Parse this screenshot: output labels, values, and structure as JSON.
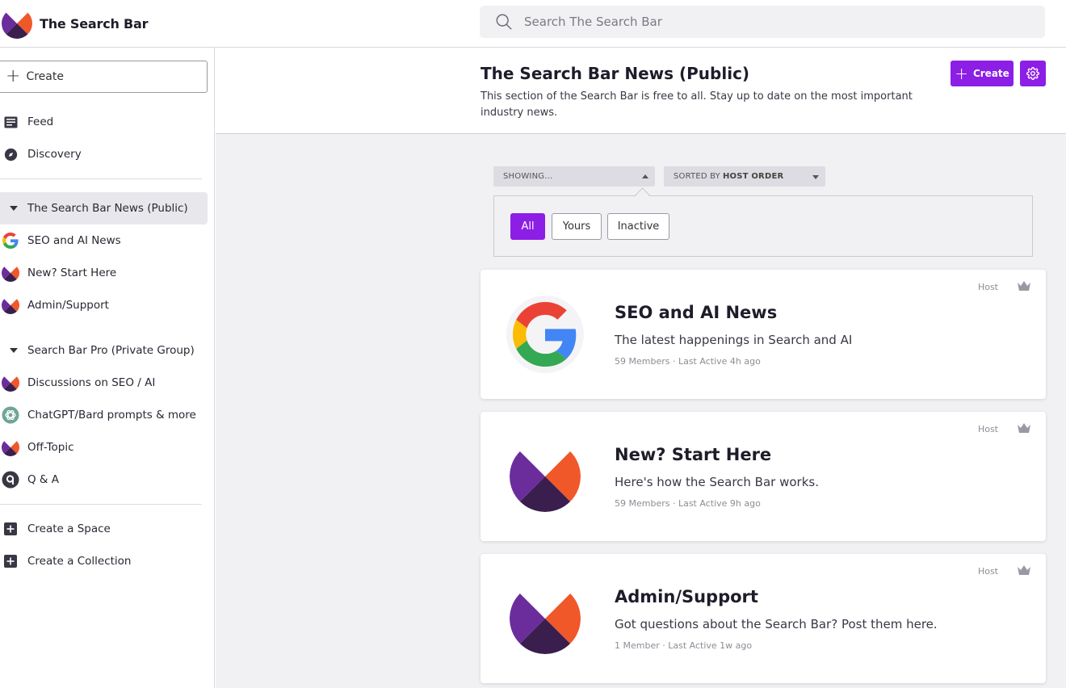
{
  "app": {
    "name": "The Search Bar"
  },
  "search": {
    "placeholder": "Search The Search Bar"
  },
  "sidebar": {
    "create_label": "Create",
    "top_items": [
      {
        "label": "Feed",
        "icon": "feed-icon"
      },
      {
        "label": "Discovery",
        "icon": "compass-icon"
      }
    ],
    "groups": [
      {
        "label": "The Search Bar News (Public)",
        "expanded": true,
        "items": [
          {
            "label": "SEO and AI News",
            "icon": "google-icon"
          },
          {
            "label": "New? Start Here",
            "icon": "search-bar-logo-icon"
          },
          {
            "label": "Admin/Support",
            "icon": "search-bar-logo-icon"
          }
        ]
      },
      {
        "label": "Search Bar Pro (Private Group)",
        "expanded": true,
        "items": [
          {
            "label": "Discussions on SEO / AI",
            "icon": "search-bar-logo-icon"
          },
          {
            "label": "ChatGPT/Bard prompts & more",
            "icon": "openai-icon"
          },
          {
            "label": "Off-Topic",
            "icon": "search-bar-logo-icon"
          },
          {
            "label": "Q & A",
            "icon": "q-icon"
          }
        ]
      }
    ],
    "bottom_items": [
      {
        "label": "Create a Space",
        "icon": "plus-square-icon"
      },
      {
        "label": "Create a Collection",
        "icon": "plus-square-icon"
      }
    ]
  },
  "header": {
    "title": "The Search Bar News (Public)",
    "description": "This section of the Search Bar is free to all. Stay up to date on the most important industry news.",
    "create_label": "Create"
  },
  "filters": {
    "showing_label": "SHOWING...",
    "sorted_prefix": "SORTED BY",
    "sorted_value": "HOST ORDER",
    "buttons": [
      "All",
      "Yours",
      "Inactive"
    ],
    "selected": "All"
  },
  "cards": [
    {
      "title": "SEO and AI News",
      "description": "The latest happenings in Search and AI",
      "meta": "59 Members · Last Active 4h ago",
      "badge": "Host",
      "avatar": "google-logo"
    },
    {
      "title": "New? Start Here",
      "description": "Here's how the Search Bar works.",
      "meta": "59 Members · Last Active 9h ago",
      "badge": "Host",
      "avatar": "search-bar-logo"
    },
    {
      "title": "Admin/Support",
      "description": "Got questions about the Search Bar? Post them here.",
      "meta": "1 Member · Last Active 1w ago",
      "badge": "Host",
      "avatar": "search-bar-logo"
    }
  ],
  "colors": {
    "accent": "#8c1ee6",
    "logo_purple": "#6b2d9c",
    "logo_orange": "#f0582a",
    "logo_dark": "#3a1e4d"
  }
}
